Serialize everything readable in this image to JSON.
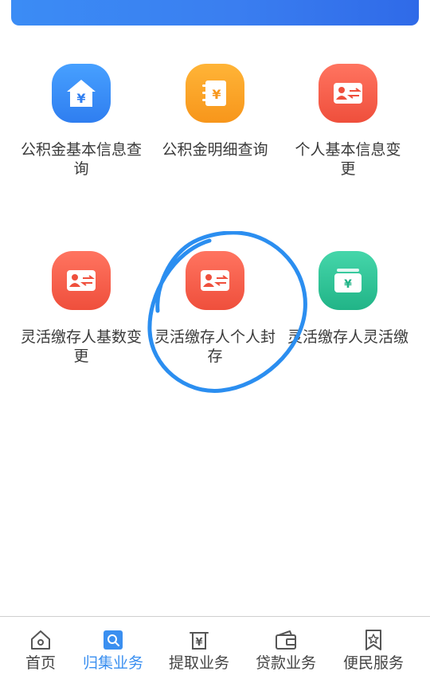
{
  "tiles": [
    {
      "label": "公积金基本信息查询",
      "icon": "house-yen-icon",
      "color": "#3a8cf5"
    },
    {
      "label": "公积金明细查询",
      "icon": "ledger-yen-icon",
      "color": "#f8a22a"
    },
    {
      "label": "个人基本信息变更",
      "icon": "id-card-transfer-icon",
      "color": "#f25c47"
    },
    {
      "label": "灵活缴存人基数变更",
      "icon": "id-card-transfer-icon",
      "color": "#f25c47"
    },
    {
      "label": "灵活缴存人个人封存",
      "icon": "id-card-transfer-icon",
      "color": "#f25c47"
    },
    {
      "label": "灵活缴存人灵活缴",
      "icon": "wallet-yen-icon",
      "color": "#2ec493"
    }
  ],
  "tabbar": {
    "items": [
      {
        "label": "首页",
        "icon": "home-icon"
      },
      {
        "label": "归集业务",
        "icon": "search-icon",
        "active": true
      },
      {
        "label": "提取业务",
        "icon": "yen-withdraw-icon"
      },
      {
        "label": "贷款业务",
        "icon": "wallet-icon"
      },
      {
        "label": "便民服务",
        "icon": "star-bookmark-icon"
      }
    ]
  },
  "annotation": {
    "kind": "hand-drawn circle",
    "color": "#2b8ef0",
    "target": "灵活缴存人个人封存"
  }
}
